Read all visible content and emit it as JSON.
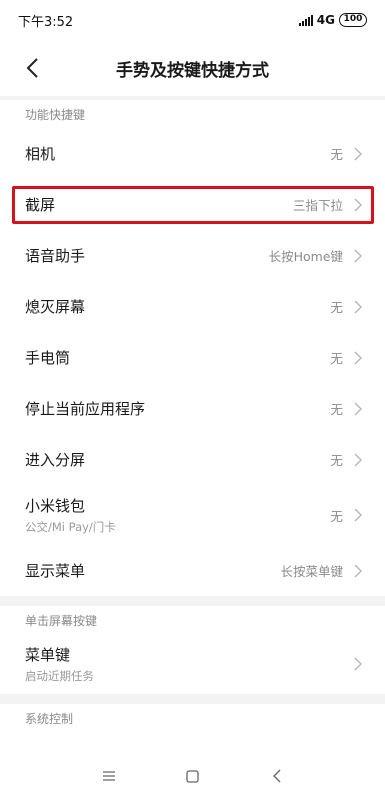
{
  "status": {
    "time": "下午3:52",
    "network": "4G",
    "battery": "100"
  },
  "header": {
    "title": "手势及按键快捷方式"
  },
  "sections": [
    {
      "title": "功能快捷键",
      "items": [
        {
          "label": "相机",
          "value": "无"
        },
        {
          "label": "截屏",
          "value": "三指下拉"
        },
        {
          "label": "语音助手",
          "value": "长按Home键"
        },
        {
          "label": "熄灭屏幕",
          "value": "无"
        },
        {
          "label": "手电筒",
          "value": "无"
        },
        {
          "label": "停止当前应用程序",
          "value": "无"
        },
        {
          "label": "进入分屏",
          "value": "无"
        },
        {
          "label": "小米钱包",
          "sub": "公交/Mi Pay/门卡",
          "value": "无"
        },
        {
          "label": "显示菜单",
          "value": "长按菜单键"
        }
      ]
    },
    {
      "title": "单击屏幕按键",
      "items": [
        {
          "label": "菜单键",
          "sub": "启动近期任务"
        }
      ]
    },
    {
      "title": "系统控制"
    }
  ],
  "icons": {
    "back": "chevron-left-icon",
    "chevron": "chevron-right-icon",
    "nav_menu": "menu-icon",
    "nav_home": "square-icon",
    "nav_back": "triangle-back-icon"
  },
  "colors": {
    "highlight": "#d6101c",
    "section_bg": "#f3f3f3"
  }
}
